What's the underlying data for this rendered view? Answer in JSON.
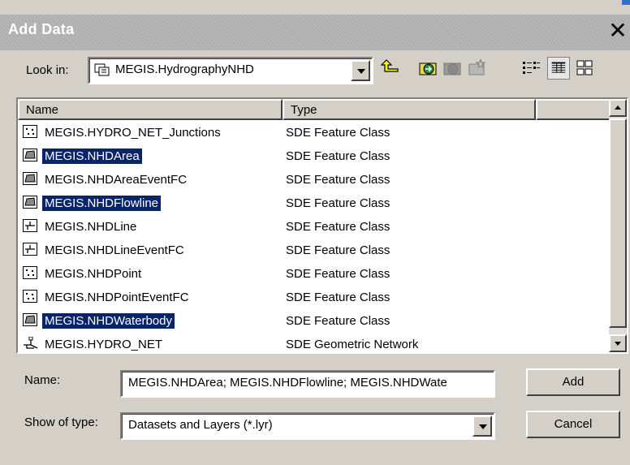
{
  "window": {
    "title": "Add Data",
    "close_glyph": "✕"
  },
  "look_in": {
    "label": "Look in:",
    "value": "MEGIS.HydrographyNHD"
  },
  "toolbar": {
    "icons": [
      "up-one-level-icon",
      "connect-folder-icon",
      "disconnect-folder-icon",
      "new-folder-icon",
      "list-view-icon",
      "details-view-icon",
      "thumbnails-view-icon"
    ]
  },
  "file_list": {
    "columns": [
      "Name",
      "Type"
    ],
    "rows": [
      {
        "name": "MEGIS.HYDRO_NET_Junctions",
        "type": "SDE Feature Class",
        "icon": "point-featureclass-icon",
        "selected": false
      },
      {
        "name": "MEGIS.NHDArea",
        "type": "SDE Feature Class",
        "icon": "polygon-featureclass-icon",
        "selected": true
      },
      {
        "name": "MEGIS.NHDAreaEventFC",
        "type": "SDE Feature Class",
        "icon": "polygon-featureclass-icon",
        "selected": false
      },
      {
        "name": "MEGIS.NHDFlowline",
        "type": "SDE Feature Class",
        "icon": "polygon-featureclass-icon",
        "selected": true
      },
      {
        "name": "MEGIS.NHDLine",
        "type": "SDE Feature Class",
        "icon": "line-featureclass-icon",
        "selected": false
      },
      {
        "name": "MEGIS.NHDLineEventFC",
        "type": "SDE Feature Class",
        "icon": "line-featureclass-icon",
        "selected": false
      },
      {
        "name": "MEGIS.NHDPoint",
        "type": "SDE Feature Class",
        "icon": "point-featureclass-icon",
        "selected": false
      },
      {
        "name": "MEGIS.NHDPointEventFC",
        "type": "SDE Feature Class",
        "icon": "point-featureclass-icon",
        "selected": false
      },
      {
        "name": "MEGIS.NHDWaterbody",
        "type": "SDE Feature Class",
        "icon": "polygon-featureclass-icon",
        "selected": true
      },
      {
        "name": "MEGIS.HYDRO_NET",
        "type": "SDE Geometric Network",
        "icon": "geometric-network-icon",
        "selected": false
      }
    ]
  },
  "name_field": {
    "label": "Name:",
    "value": "MEGIS.NHDArea; MEGIS.NHDFlowline; MEGIS.NHDWate"
  },
  "type_field": {
    "label": "Show of type:",
    "value": "Datasets and Layers (*.lyr)"
  },
  "buttons": {
    "add": "Add",
    "cancel": "Cancel"
  },
  "colors": {
    "selection": "#0a246a",
    "dialog_bg": "#d4d0c8"
  }
}
